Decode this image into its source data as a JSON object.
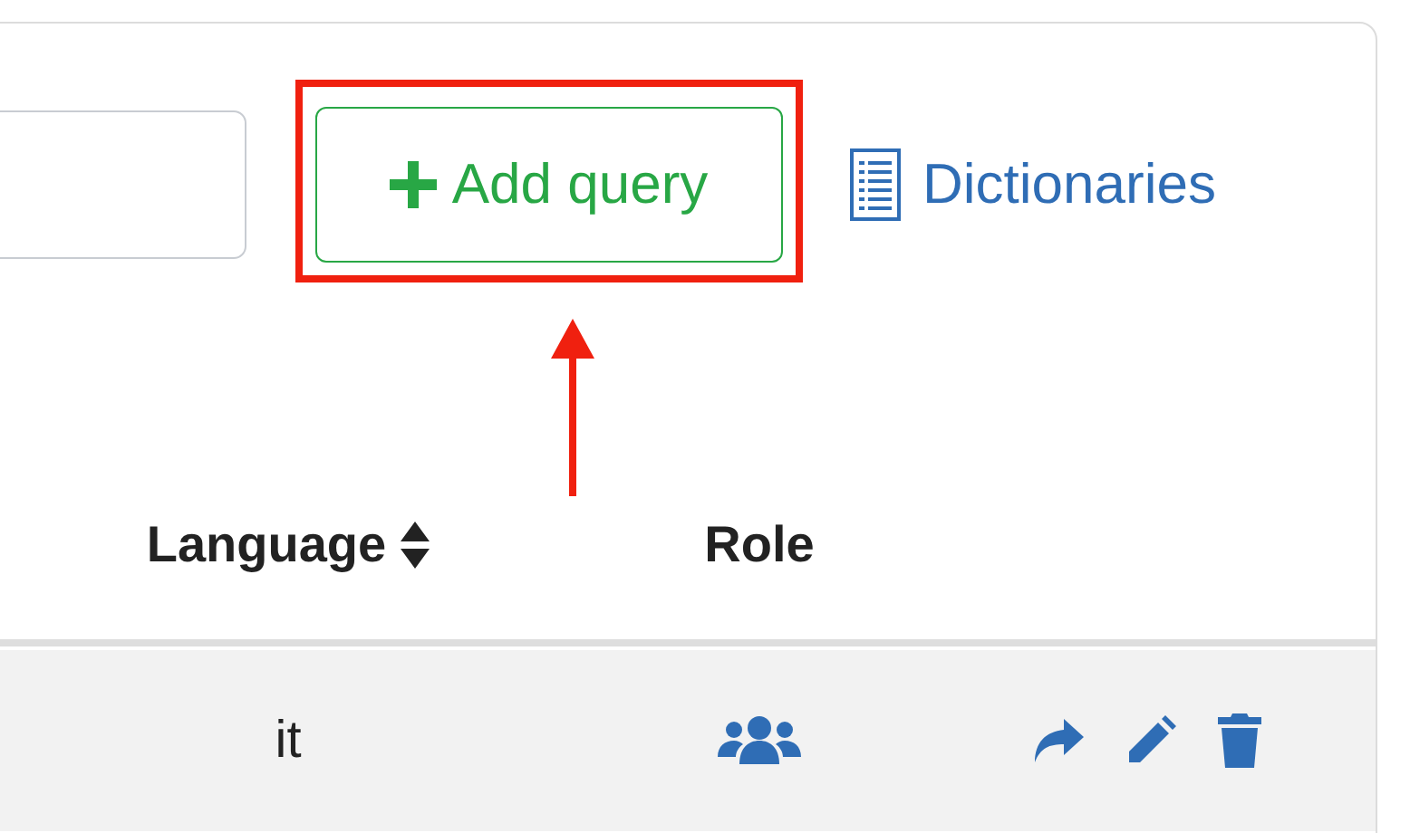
{
  "toolbar": {
    "add_button": {
      "label": "Add query"
    },
    "dictionaries_link": {
      "label": "Dictionaries"
    }
  },
  "table": {
    "columns": [
      {
        "label": "Language",
        "sortable": true
      },
      {
        "label": "Role",
        "sortable": false
      }
    ],
    "rows": [
      {
        "language": "it",
        "role": {
          "kind": "group"
        },
        "actions": [
          {
            "kind": "share"
          },
          {
            "kind": "edit"
          },
          {
            "kind": "delete"
          }
        ]
      }
    ]
  }
}
